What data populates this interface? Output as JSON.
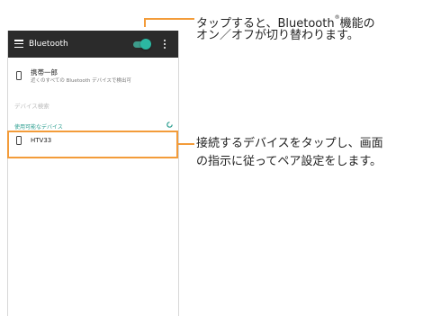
{
  "appbar": {
    "title": "Bluetooth",
    "icons": [
      "menu-icon",
      "toggle-switch",
      "overflow-menu-icon"
    ]
  },
  "self_device": {
    "name": "携帯一郎",
    "subtitle": "近くのすべての Bluetooth デバイスで検出可"
  },
  "search_label": "デバイス検索",
  "available_section": {
    "header": "使用可能なデバイス",
    "devices": [
      {
        "name": "HTV33"
      }
    ]
  },
  "toggle": {
    "state": "on",
    "accent_color": "#2bb7a2"
  },
  "callouts": {
    "toggle": {
      "line1_before": "タップすると、Bluetooth",
      "line1_sup": "®",
      "line1_after": "機能の",
      "line2": "オン／オフが切り替わります。"
    },
    "device": {
      "line1": "接続するデバイスをタップし、画面",
      "line2": "の指示に従ってペア設定をします。"
    }
  },
  "colors": {
    "appbar": "#2b2b2b",
    "accent": "#2a9d8f",
    "highlight": "#f39c3a"
  }
}
